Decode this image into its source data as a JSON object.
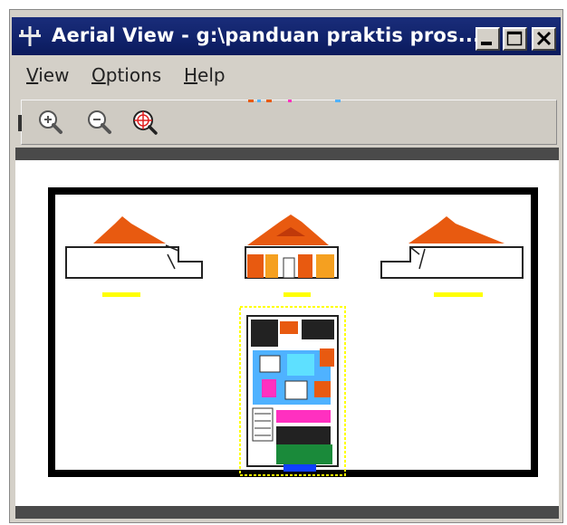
{
  "window": {
    "title": "Aerial View - g:\\panduan praktis pros..."
  },
  "menu": {
    "items": [
      {
        "label": "View",
        "accel": "V",
        "rest": "iew"
      },
      {
        "label": "Options",
        "accel": "O",
        "rest": "ptions"
      },
      {
        "label": "Help",
        "accel": "H",
        "rest": "elp"
      }
    ]
  },
  "toolbar": {
    "tools": [
      {
        "icon": "zoom-in-icon"
      },
      {
        "icon": "zoom-out-icon"
      },
      {
        "icon": "global-zoom-icon"
      }
    ]
  },
  "colors": {
    "titlebar": "#10226a",
    "roof": "#e85a10",
    "highlight": "#ffff00",
    "plan_blue": "#4fb2ff"
  }
}
